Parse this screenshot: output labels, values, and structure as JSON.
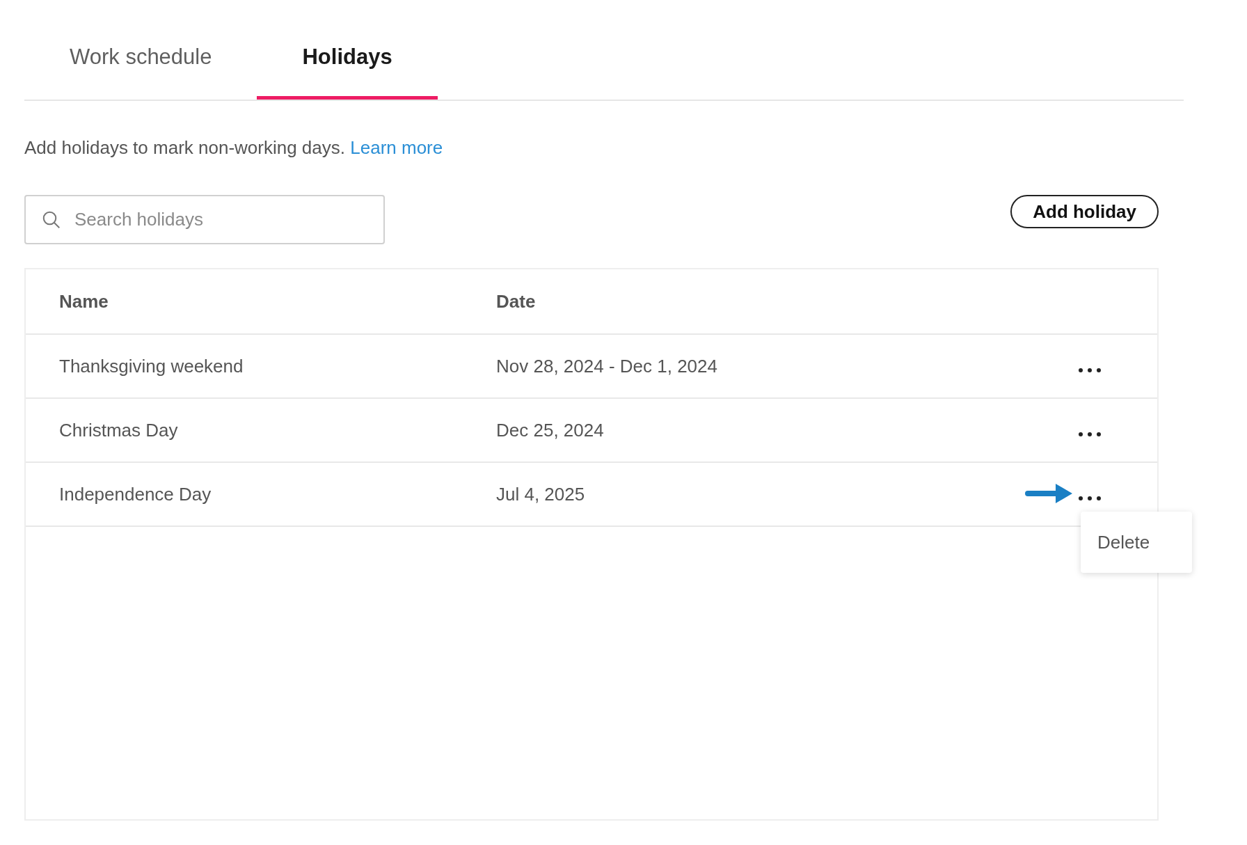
{
  "tabs": [
    {
      "label": "Work schedule",
      "selected": false
    },
    {
      "label": "Holidays",
      "selected": true
    }
  ],
  "description": {
    "text": "Add holidays to mark non-working days.",
    "link": "Learn more"
  },
  "search": {
    "placeholder": "Search holidays"
  },
  "add_button": "Add holiday",
  "table": {
    "columns": [
      "Name",
      "Date"
    ],
    "rows": [
      {
        "name": "Thanksgiving weekend",
        "date": "Nov 28, 2024 - Dec 1, 2024",
        "menu_open": false
      },
      {
        "name": "Christmas Day",
        "date": "Dec 25, 2024",
        "menu_open": false
      },
      {
        "name": "Independence Day",
        "date": "Jul 4, 2025",
        "menu_open": true
      }
    ]
  },
  "row_menu": {
    "items": [
      "Delete"
    ]
  }
}
